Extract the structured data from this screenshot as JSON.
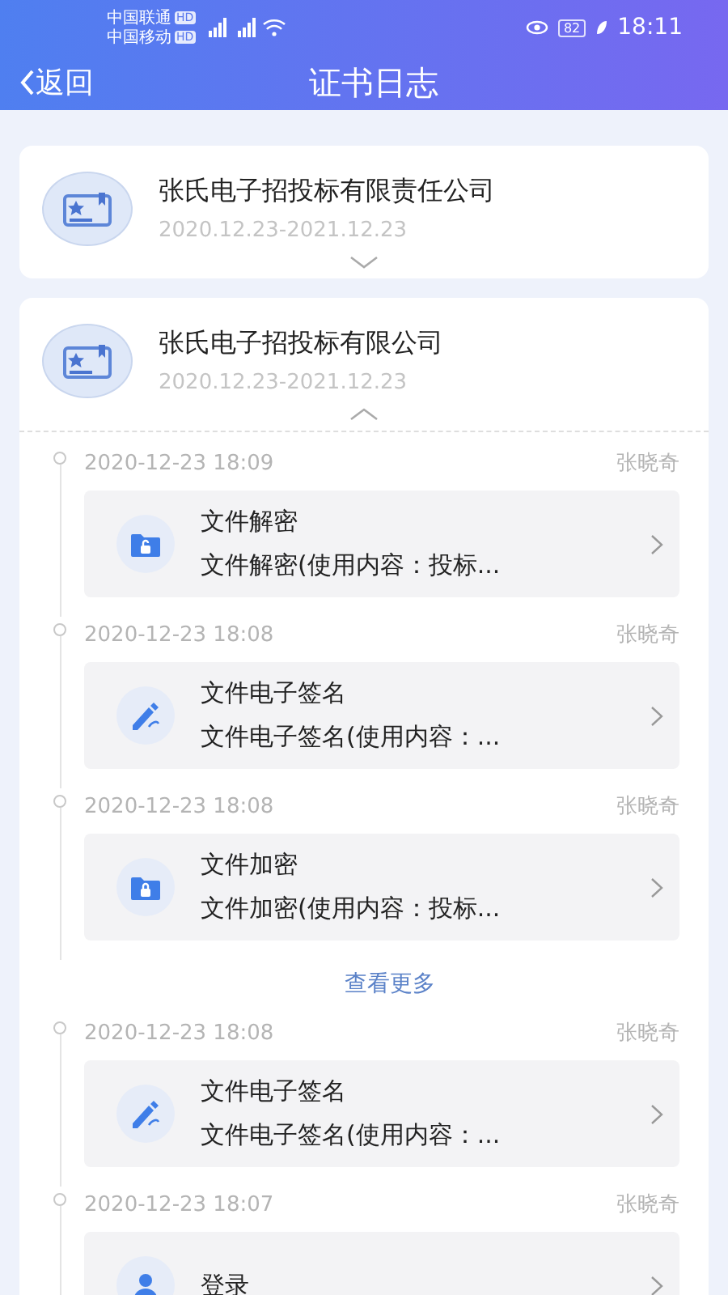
{
  "status_bar": {
    "carriers": [
      {
        "name": "中国联通",
        "badge": "HD"
      },
      {
        "name": "中国移动",
        "badge": "HD"
      }
    ],
    "battery": "82",
    "time": "18:11"
  },
  "header": {
    "back": "返回",
    "title": "证书日志"
  },
  "certificates": [
    {
      "name": "张氏电子招投标有限责任公司",
      "validity": "2020.12.23-2021.12.23",
      "expanded": false
    },
    {
      "name": "张氏电子招投标有限公司",
      "validity": "2020.12.23-2021.12.23",
      "expanded": true,
      "logs": [
        {
          "time": "2020-12-23 18:09",
          "user": "张晓奇",
          "kind": "decrypt",
          "title": "文件解密",
          "summary": "文件解密(使用内容：投标..."
        },
        {
          "time": "2020-12-23 18:08",
          "user": "张晓奇",
          "kind": "sign",
          "title": "文件电子签名",
          "summary": "文件电子签名(使用内容：..."
        },
        {
          "time": "2020-12-23 18:08",
          "user": "张晓奇",
          "kind": "encrypt",
          "title": "文件加密",
          "summary": "文件加密(使用内容：投标..."
        }
      ],
      "more": "查看更多",
      "more_logs": [
        {
          "time": "2020-12-23 18:08",
          "user": "张晓奇",
          "kind": "sign",
          "title": "文件电子签名",
          "summary": "文件电子签名(使用内容：..."
        },
        {
          "time": "2020-12-23 18:07",
          "user": "张晓奇",
          "kind": "login",
          "title": "登录"
        }
      ]
    }
  ]
}
